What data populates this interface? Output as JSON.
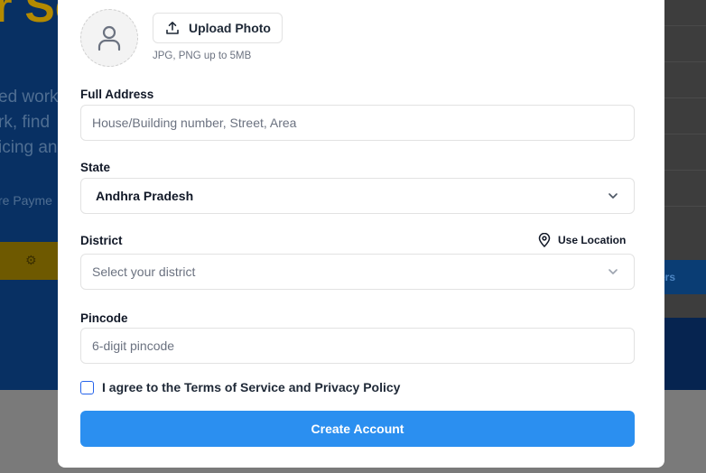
{
  "background": {
    "title_fragment": "r Se",
    "lines": [
      "ed work",
      "rk, find",
      "icing an"
    ],
    "line_small": "re Payme",
    "right_cta": "ers"
  },
  "photo": {
    "avatar_icon": "user-icon",
    "upload_icon": "upload-icon",
    "upload_label": "Upload Photo",
    "hint": "JPG, PNG up to 5MB"
  },
  "address": {
    "label": "Full Address",
    "placeholder": "House/Building number, Street, Area"
  },
  "state": {
    "label": "State",
    "value": "Andhra Pradesh"
  },
  "district": {
    "label": "District",
    "placeholder": "Select your district",
    "location_icon": "map-pin-icon",
    "location_label": "Use Location"
  },
  "pincode": {
    "label": "Pincode",
    "placeholder": "6-digit pincode"
  },
  "agreement": {
    "checked": false,
    "label": "I agree to the Terms of Service and Privacy Policy"
  },
  "submit": {
    "label": "Create Account"
  },
  "colors": {
    "primary": "#2b8ff0",
    "checkbox_border": "#2563eb",
    "overlay": "#7a7a7a"
  }
}
